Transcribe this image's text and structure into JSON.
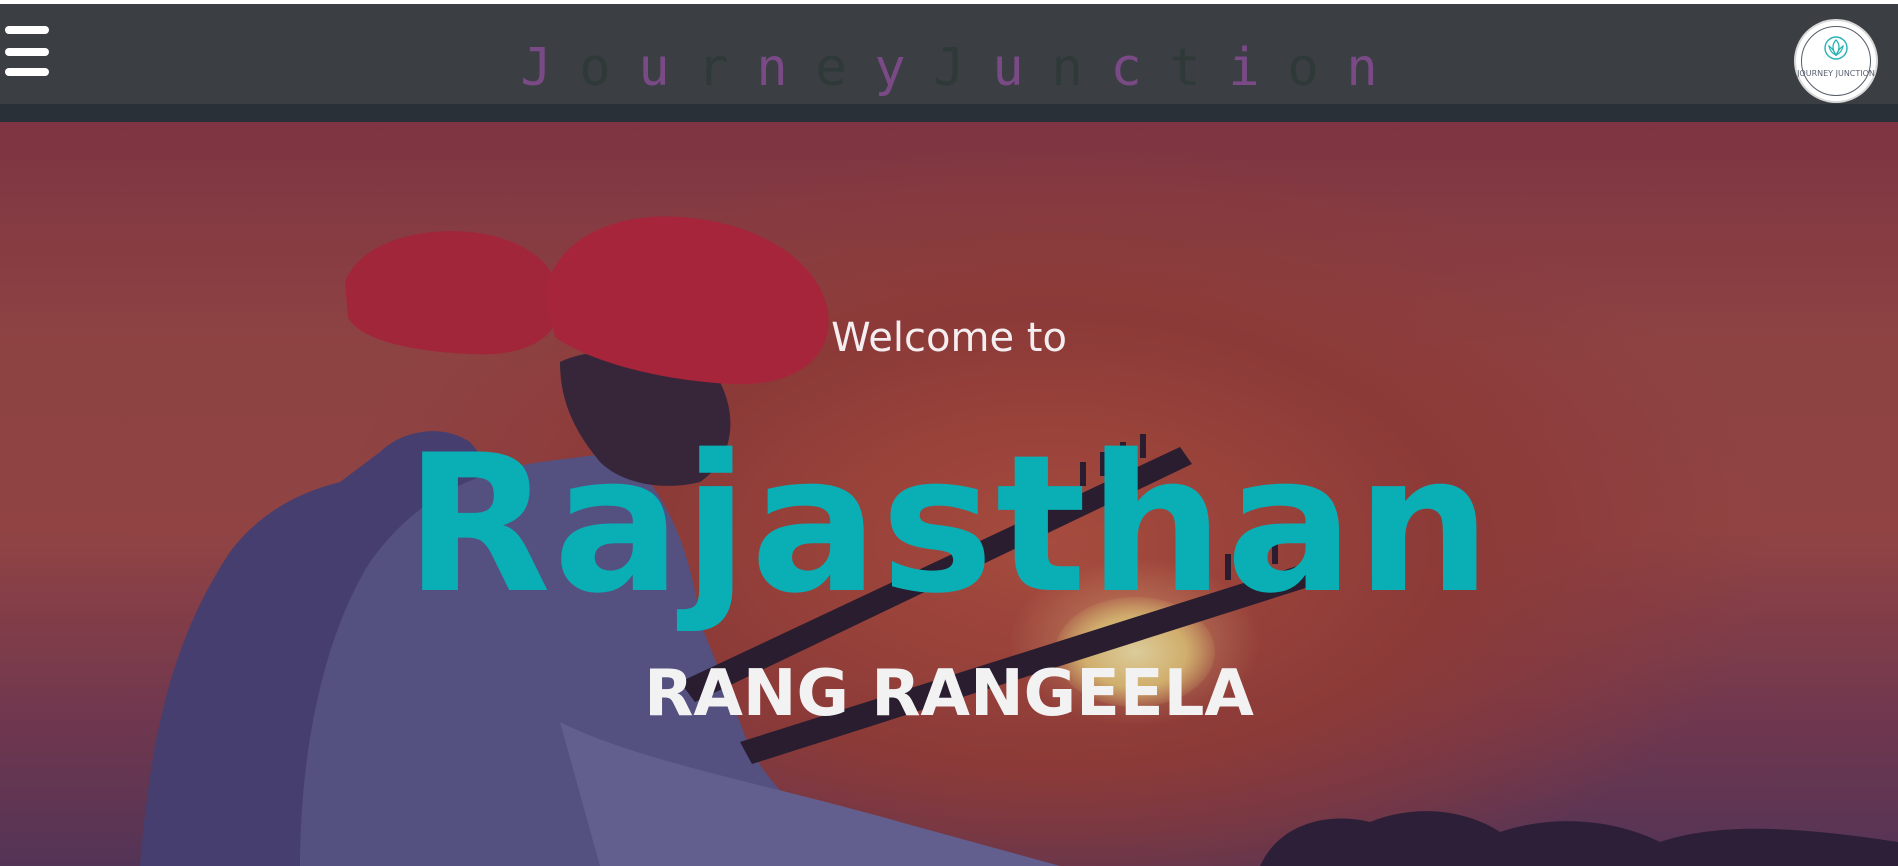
{
  "header": {
    "menu_icon": "hamburger-menu-icon",
    "brand_letters": [
      {
        "char": "J",
        "color": "#7a4a86"
      },
      {
        "char": "o",
        "color": "#2f3a38"
      },
      {
        "char": "u",
        "color": "#7a4a86"
      },
      {
        "char": "r",
        "color": "#2f3a38"
      },
      {
        "char": "n",
        "color": "#7a4a86"
      },
      {
        "char": "e",
        "color": "#2f3a38"
      },
      {
        "char": "y",
        "color": "#7a4a86"
      },
      {
        "char": "J",
        "color": "#2f3a38"
      },
      {
        "char": "u",
        "color": "#7a4a86"
      },
      {
        "char": "n",
        "color": "#2f3a38"
      },
      {
        "char": "c",
        "color": "#7a4a86"
      },
      {
        "char": "t",
        "color": "#2f3a38"
      },
      {
        "char": "i",
        "color": "#7a4a86"
      },
      {
        "char": "o",
        "color": "#2f3a38"
      },
      {
        "char": "n",
        "color": "#7a4a86"
      }
    ],
    "logo_text": "JOURNEY JUNCTION",
    "logo_icon": "lotus-logo-icon"
  },
  "hero": {
    "welcome": "Welcome to",
    "title": "Rajasthan",
    "subtitle": "RANG RANGEELA",
    "title_color": "#0aaeb5"
  }
}
